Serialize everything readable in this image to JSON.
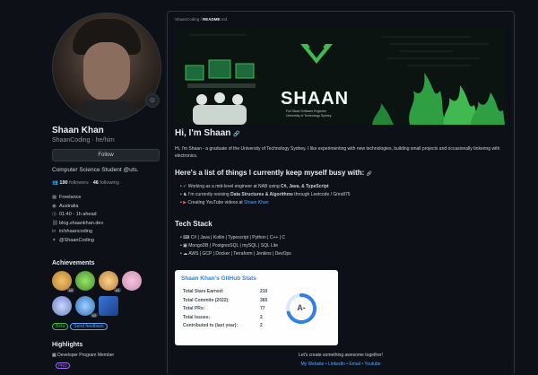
{
  "profile": {
    "name": "Shaan Khan",
    "login": "ShaanCoding · he/him",
    "follow_label": "Follow",
    "bio": "Computer Science Student @uts.",
    "followers_count": "190",
    "followers_label": "followers",
    "following_count": "46",
    "following_label": "following",
    "meta": [
      {
        "icon": "company-icon",
        "glyph": "▦",
        "text": "Freelance"
      },
      {
        "icon": "location-icon",
        "glyph": "◉",
        "text": "Australia"
      },
      {
        "icon": "clock-icon",
        "glyph": "◷",
        "text": "01:40 - 1h ahead"
      },
      {
        "icon": "link-icon",
        "glyph": "⛓",
        "text": "blog.shaankhan.dev"
      },
      {
        "icon": "linkedin-icon",
        "glyph": "in",
        "text": "in/shaancoding"
      },
      {
        "icon": "twitter-icon",
        "glyph": "✦",
        "text": "@ShaanCoding"
      }
    ],
    "achievements_title": "Achievements",
    "badge_counts": [
      "x4",
      "x3",
      "x2"
    ],
    "pills": [
      "Beta",
      "Send feedback"
    ],
    "highlights_title": "Highlights",
    "highlight_item": "Developer Program Member",
    "pro_label": "PRO"
  },
  "readme": {
    "path_prefix": "ShaanCoding / ",
    "path_file": "README",
    "path_suffix": ".md",
    "banner_title": "SHAAN",
    "banner_sub_1": "Full Stack Software Engineer",
    "banner_sub_2": "University of Technology Sydney",
    "greeting": "Hi, I'm Shaan",
    "intro": "Hi, I'm Shaan - a graduate of the University of Technology Sydney. I like experimenting with new technologies, building small projects and occasionally tinkering with electronics.",
    "busy_title": "Here's a list of things I currently keep myself busy with:",
    "busy": [
      {
        "glyph": "✔",
        "pre": "Working as a mid-level engineer at NAB using ",
        "bold": "C#, Java, & TypeScript",
        "post": ""
      },
      {
        "glyph": "♞",
        "pre": "I'm currently revising ",
        "bold": "Data Structures & Algorithms",
        "post": " through Leetcode / GrindI75"
      },
      {
        "glyph": "▶",
        "pre": "Creating YouTube videos at ",
        "link": "Shaan Khan",
        "post": ""
      }
    ],
    "tech_title": "Tech Stack",
    "tech": [
      {
        "glyph": "⌨",
        "text": "C# | Java | Kotlin | Typescript | Python | C++ | C"
      },
      {
        "glyph": "▣",
        "text": "MongoDB | PostgresSQL | mySQL | SQL Lite"
      },
      {
        "glyph": "☁",
        "text": "AWS | GCP | Docker | Terraform | Jenkins | DevOps"
      }
    ],
    "stats": {
      "title": "Shaan Khan's GitHub Stats",
      "rows": [
        {
          "label": "Total Stars Earned:",
          "value": "210"
        },
        {
          "label": "Total Commits (2022):",
          "value": "365"
        },
        {
          "label": "Total PRs:",
          "value": "77"
        },
        {
          "label": "Total Issues:",
          "value": "2"
        },
        {
          "label": "Contributed to (last year):",
          "value": "2"
        }
      ],
      "grade": "A-",
      "rank_progress": 0.7
    },
    "cta": "Let's create something awesome together!",
    "links": "My Website • LinkedIn • Email • Youtube"
  },
  "colors": {
    "accent": "#58a6ff",
    "brand_green": "#3fb950",
    "stats_blue": "#2f80ed"
  }
}
